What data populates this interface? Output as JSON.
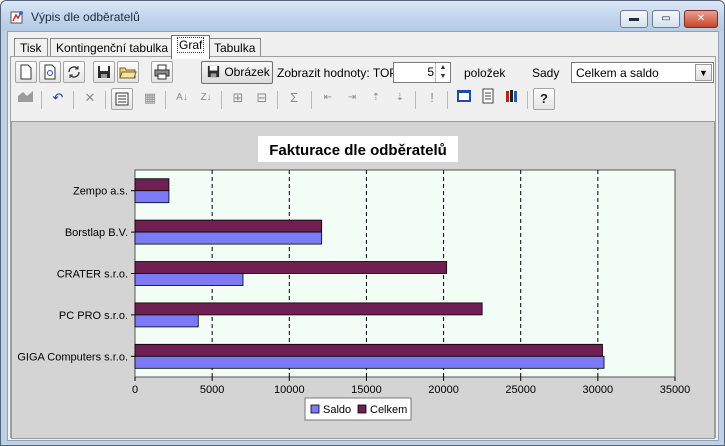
{
  "window": {
    "title": "Výpis dle odběratelů",
    "controls": {
      "minimize": "▬",
      "maximize": "▭",
      "close": "✕"
    }
  },
  "tabs": [
    {
      "label": "Tisk",
      "active": false
    },
    {
      "label": "Kontingenční tabulka",
      "active": false
    },
    {
      "label": "Graf",
      "active": true
    },
    {
      "label": "Tabulka",
      "active": false
    }
  ],
  "toolbar": {
    "image_button_label": "Obrázek",
    "top_label": "Zobrazit hodnoty: TOP",
    "top_value": "5",
    "items_label": "položek",
    "sets_label": "Sady",
    "sets_value": "Celkem a saldo",
    "icons": [
      "new-page-icon",
      "print-preview-icon",
      "refresh-icon",
      "save-icon",
      "open-folder-icon",
      "printer-icon",
      "save-image-icon"
    ],
    "icons_row2": [
      "chart-type-icon",
      "undo-icon",
      "delete-icon",
      "properties-list-icon",
      "grid-icon",
      "sort-ascending-icon",
      "sort-descending-icon",
      "filter-icon",
      "filter-clear-icon",
      "sum-icon",
      "move-left-icon",
      "move-right-icon",
      "move-up-icon",
      "move-down-icon",
      "exclamation-icon",
      "export-icon",
      "document-icon",
      "library-icon",
      "help-icon"
    ]
  },
  "colors": {
    "saldo": "#7b7bf7",
    "celkem": "#6f1f52",
    "plot_bg": "#f2fdf6"
  },
  "chart_data": {
    "type": "bar",
    "orientation": "horizontal",
    "title": "Fakturace dle odběratelů",
    "categories": [
      "Zempo a.s.",
      "Borstlap B.V.",
      "CRATER s.r.o.",
      "PC PRO s.r.o.",
      "GIGA Computers s.r.o."
    ],
    "series": [
      {
        "name": "Saldo",
        "values": [
          2200,
          12100,
          7000,
          4100,
          30400
        ]
      },
      {
        "name": "Celkem",
        "values": [
          2200,
          12100,
          20200,
          22500,
          30300
        ]
      }
    ],
    "xlim": [
      0,
      35000
    ],
    "xticks": [
      "0",
      "5000",
      "10000",
      "15000",
      "20000",
      "25000",
      "30000",
      "35000"
    ],
    "grid": true,
    "legend_position": "bottom"
  }
}
